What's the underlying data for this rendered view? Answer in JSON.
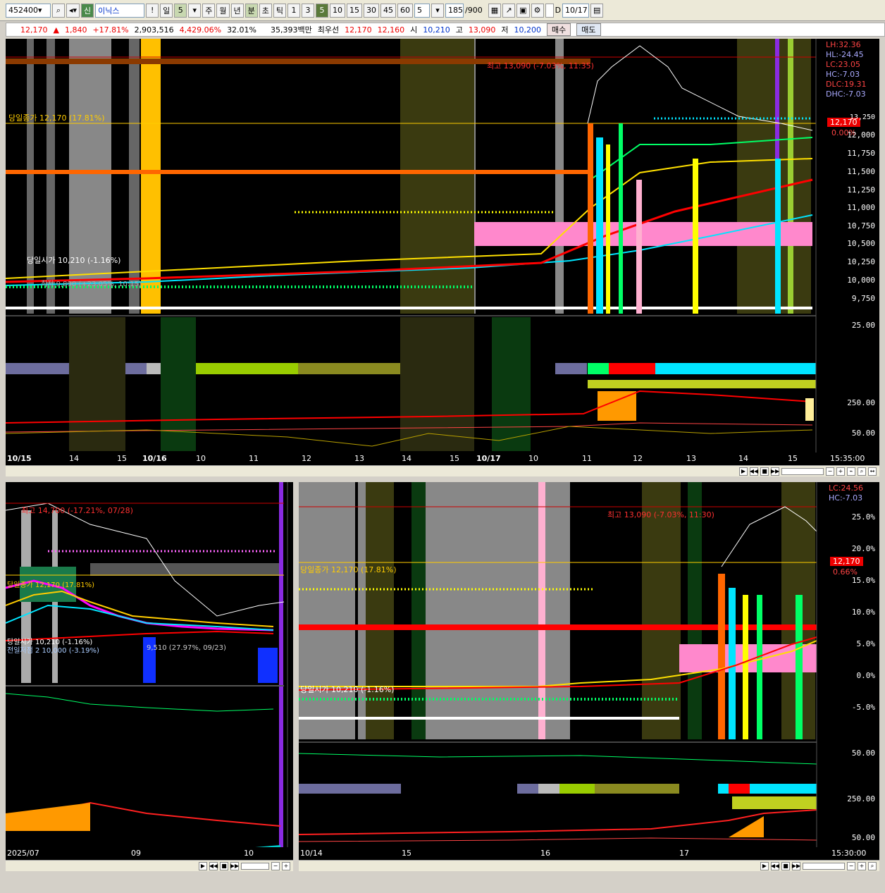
{
  "toolbar": {
    "code": "452400",
    "market": "신",
    "name": "이닉스",
    "exclaim": "!",
    "period_day": "일",
    "period_num": "5",
    "periods": [
      "주",
      "월",
      "년",
      "분",
      "초",
      "틱"
    ],
    "minutes": [
      "1",
      "3",
      "5",
      "10",
      "15",
      "30",
      "45",
      "60"
    ],
    "sel": "5",
    "count": "185",
    "count_total": "/900",
    "date": "10/17",
    "d_label": "D"
  },
  "quote": {
    "price": "12,170",
    "change": "1,840",
    "change_pct": "+17.81%",
    "volume": "2,903,516",
    "vol_ratio": "4,429.06%",
    "turnover": "32.01%",
    "amount": "35,393백만",
    "best_label": "최우선",
    "ask": "12,170",
    "bid": "12,160",
    "open_label": "시",
    "open": "10,210",
    "high_label": "고",
    "high": "13,090",
    "low_label": "저",
    "low": "10,200",
    "buy": "매수",
    "sell": "매도"
  },
  "main_chart": {
    "info": [
      "LH:32.36",
      "HL:-24.45",
      "LC:23.05",
      "HC:-7.03",
      "DLC:19.31",
      "DHC:-7.03"
    ],
    "annot_high": "최고 13,090 (-7.03%, 11:35)",
    "annot_close": "당일종가 12,170 (17.81%)",
    "annot_open": "당일시가 10,210 (-1.16%)",
    "annot_low": "최저 9,890 (+23.05%, 10:15)",
    "price_tag": "12,170",
    "pct_tag": "0.00%",
    "y_ticks": [
      "13,250",
      "12,000",
      "11,750",
      "11,500",
      "11,250",
      "11,000",
      "10,750",
      "10,500",
      "10,250",
      "10,000",
      "9,750"
    ],
    "sub_ticks": [
      "25.00",
      "250.00",
      "50.00"
    ],
    "x_labels": [
      "10/15",
      "14",
      "15",
      "10/16",
      "10",
      "11",
      "12",
      "13",
      "14",
      "15",
      "10/17",
      "10",
      "11",
      "12",
      "13",
      "14",
      "15"
    ],
    "time": "15:35:00"
  },
  "left_chart": {
    "annot_high": "최고 14,700 (-17.21%, 07/28)",
    "annot_close": "당일종가 12,170 (17.81%)",
    "annot_open": "당일시가 10,210 (-1.16%)",
    "annot_pre": "전일저점 2 10,000 (-3.19%)",
    "annot_low": "9,510 (27.97%, 09/23)",
    "x_labels": [
      "2025/07",
      "09",
      "10"
    ]
  },
  "right_chart": {
    "info": [
      "LC:24.56",
      "HC:-7.03"
    ],
    "annot_high": "최고 13,090 (-7.03%, 11:30)",
    "annot_close": "당일종가 12,170 (17.81%)",
    "annot_open": "당일시가 10,210 (-1.16%)",
    "price_tag": "12,170",
    "pct_tag": "0.66%",
    "y_ticks": [
      "25.0%",
      "20.0%",
      "15.0%",
      "10.0%",
      "5.0%",
      "0.0%",
      "-5.0%"
    ],
    "sub_ticks": [
      "50.00",
      "250.00",
      "50.00"
    ],
    "x_labels": [
      "10/14",
      "15",
      "16",
      "17"
    ],
    "time": "15:30:00"
  },
  "colors": {
    "up": "#ff0000",
    "down": "#0055ff",
    "accent_yellow": "#ffcc00"
  }
}
